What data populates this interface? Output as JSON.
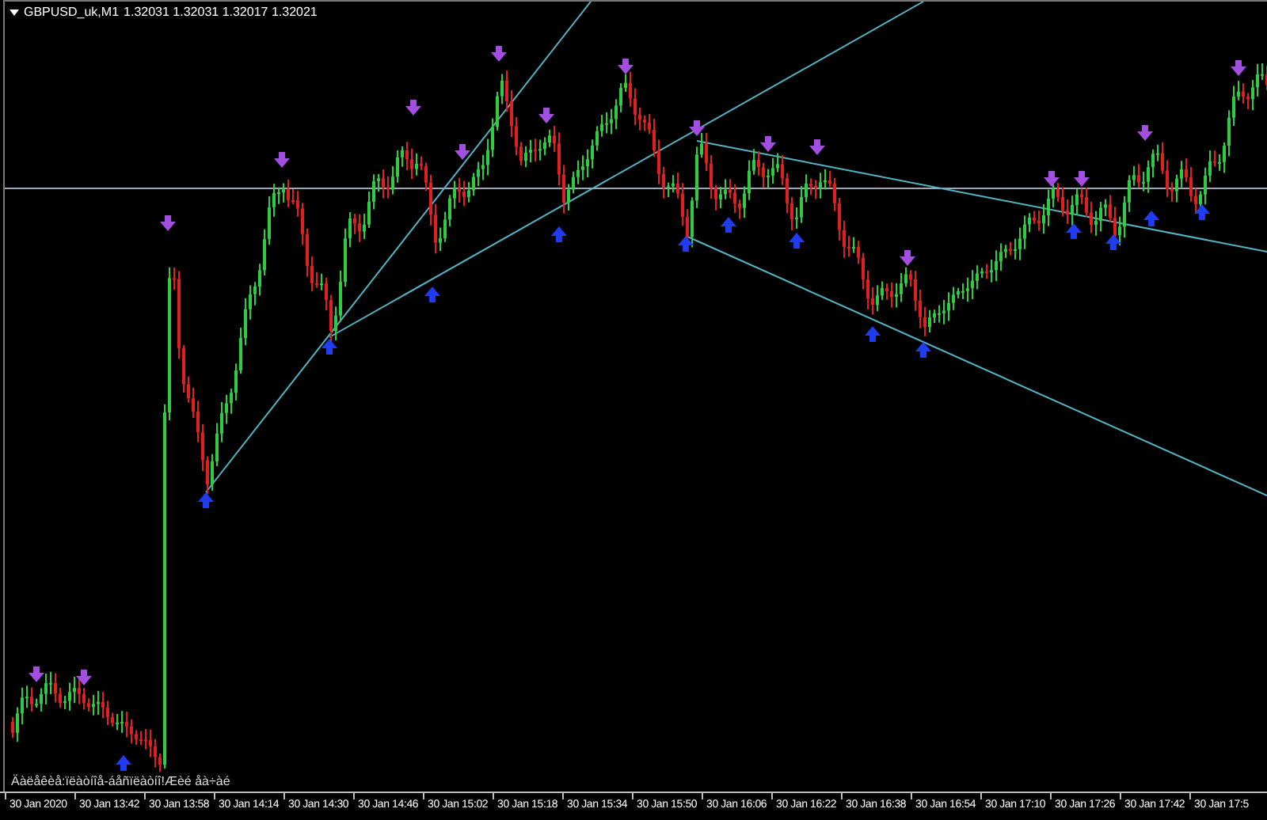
{
  "chart_window": {
    "symbol": "GBPUSD_uk,M1",
    "ohlc": "1.32031 1.32031 1.32017 1.32021"
  },
  "comment": "Äàëåêèå:ïëàòíîå-áåñïëàòíî!Æèé åà÷àé",
  "time_axis": [
    "30 Jan 2020",
    "30 Jan 13:42",
    "30 Jan 13:58",
    "30 Jan 14:14",
    "30 Jan 14:30",
    "30 Jan 14:46",
    "30 Jan 15:02",
    "30 Jan 15:18",
    "30 Jan 15:34",
    "30 Jan 15:50",
    "30 Jan 16:06",
    "30 Jan 16:22",
    "30 Jan 16:38",
    "30 Jan 16:54",
    "30 Jan 17:10",
    "30 Jan 17:26",
    "30 Jan 17:42",
    "30 Jan 17:5"
  ]
}
